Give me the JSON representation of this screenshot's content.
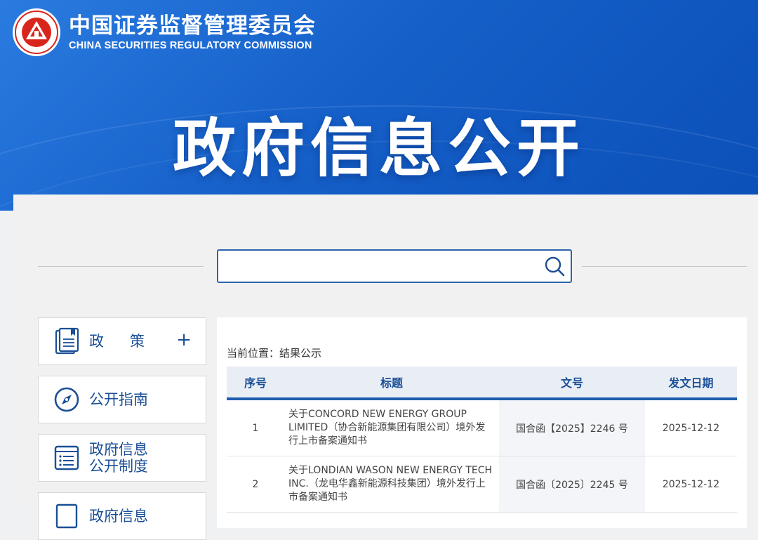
{
  "header": {
    "org_name_cn": "中国证券监督管理委员会",
    "org_name_en": "CHINA SECURITIES REGULATORY COMMISSION",
    "seal_text": "中国证券监督管理委员会",
    "seal_text_en": "CHINA SECURITIES REGULATORY COMMISSION",
    "hero_title": "政府信息公开",
    "brand_color": "#1560c9"
  },
  "search": {
    "value": "",
    "placeholder": ""
  },
  "sidebar": {
    "items": [
      {
        "label": "政　策",
        "icon": "book-icon",
        "expandable": true,
        "expand_symbol": "+"
      },
      {
        "label": "公开指南",
        "icon": "compass-icon"
      },
      {
        "label": "政府信息公开制度",
        "line1": "政府信息",
        "line2": "公开制度",
        "icon": "list-document-icon"
      },
      {
        "label": "政府信息",
        "icon": "document-icon"
      }
    ]
  },
  "breadcrumb": "当前位置：结果公示",
  "table": {
    "headers": [
      "序号",
      "标题",
      "文号",
      "发文日期"
    ],
    "rows": [
      {
        "index": "1",
        "title": "关于CONCORD NEW ENERGY GROUP LIMITED（协合新能源集团有限公司）境外发行上市备案通知书",
        "doc_no": "国合函【2025】2246 号",
        "date": "2025-12-12"
      },
      {
        "index": "2",
        "title": "关于LONDIAN WASON NEW ENERGY TECH INC.（龙电华鑫新能源科技集团）境外发行上市备案通知书",
        "doc_no": "国合函〔2025〕2245 号",
        "date": "2025-12-12"
      }
    ]
  }
}
